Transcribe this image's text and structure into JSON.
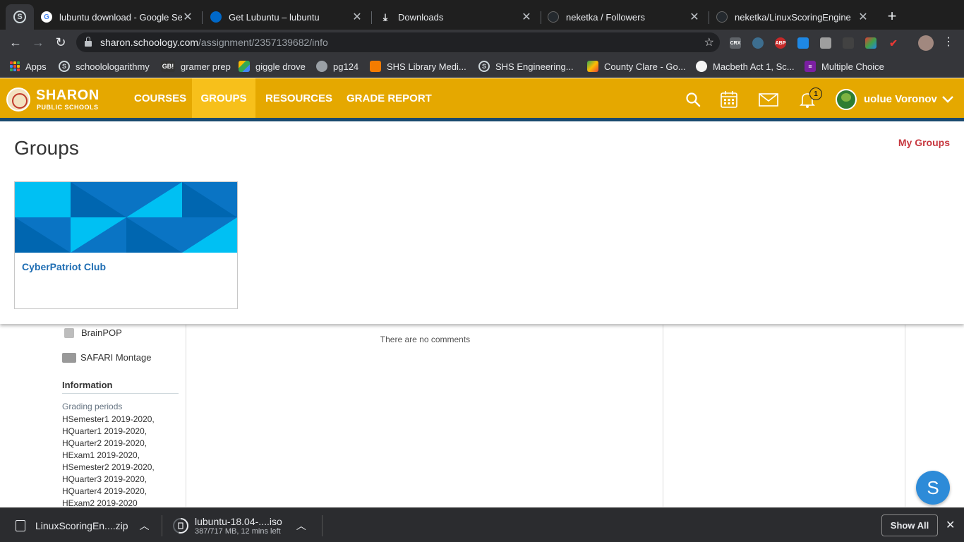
{
  "browser": {
    "tabs": [
      {
        "title": "lubuntu download - Google Sea",
        "close": "✕",
        "favicon": "google-icon"
      },
      {
        "title": "Get Lubuntu – lubuntu",
        "close": "✕",
        "favicon": "lubuntu-icon"
      },
      {
        "title": "Downloads",
        "close": "✕",
        "favicon": "download-icon"
      },
      {
        "title": "neketka / Followers",
        "close": "✕",
        "favicon": "github-icon"
      },
      {
        "title": "neketka/LinuxScoringEngine",
        "close": "✕",
        "favicon": "github-icon"
      }
    ],
    "app_badge": "S",
    "new_tab": "+",
    "url": {
      "host": "sharon.schoology.com",
      "path": "/assignment/2357139682/info"
    },
    "extensions": [
      "CRX",
      "ABP"
    ],
    "bookmarks": [
      {
        "label": "Apps",
        "icon": "apps-grid-icon"
      },
      {
        "label": "schoolologarithmy",
        "icon": "schoology-icon"
      },
      {
        "label": "gramer prep",
        "icon": "gb-icon",
        "icon_text": "GB!"
      },
      {
        "label": "giggle drove",
        "icon": "drive-icon"
      },
      {
        "label": "pg124",
        "icon": "globe-icon"
      },
      {
        "label": "SHS Library Medi...",
        "icon": "library-icon"
      },
      {
        "label": "SHS Engineering...",
        "icon": "schoology-icon"
      },
      {
        "label": "County Clare - Go...",
        "icon": "maps-icon"
      },
      {
        "label": "Macbeth Act 1, Sc...",
        "icon": "quiz-icon"
      },
      {
        "label": "Multiple Choice",
        "icon": "list-icon"
      }
    ]
  },
  "header": {
    "brand_line1": "SHARON",
    "brand_line2": "PUBLIC SCHOOLS",
    "menu": [
      "COURSES",
      "GROUPS",
      "RESOURCES",
      "GRADE REPORT"
    ],
    "active_menu": "GROUPS",
    "notification_count": "1",
    "username": "uolue Voronov",
    "colors": {
      "header": "#e5a800",
      "active": "#f7c01b",
      "bar": "#1b4a6f"
    }
  },
  "groups_panel": {
    "title": "Groups",
    "my_groups_link": "My Groups",
    "groups": [
      {
        "name": "CyberPatriot Club"
      }
    ]
  },
  "page": {
    "links": [
      {
        "label": "BrainPOP",
        "icon": "brainpop-icon"
      },
      {
        "label": "SAFARI Montage",
        "icon": "safari-montage-icon"
      }
    ],
    "information_heading": "Information",
    "grading_periods_label": "Grading periods",
    "grading_periods": [
      "HSemester1 2019-2020,",
      "HQuarter1 2019-2020,",
      "HQuarter2 2019-2020,",
      "HExam1 2019-2020,",
      "HSemester2 2019-2020,",
      "HQuarter3 2019-2020,",
      "HQuarter4 2019-2020,",
      "HExam2 2019-2020"
    ],
    "no_comments": "There are no comments",
    "fab_letter": "S"
  },
  "downloads": {
    "items": [
      {
        "name": "LinuxScoringEn....zip",
        "status": ""
      },
      {
        "name": "lubuntu-18.04-....iso",
        "status": "387/717 MB, 12 mins left",
        "progress": 0.54
      }
    ],
    "show_all": "Show All",
    "close": "✕"
  }
}
